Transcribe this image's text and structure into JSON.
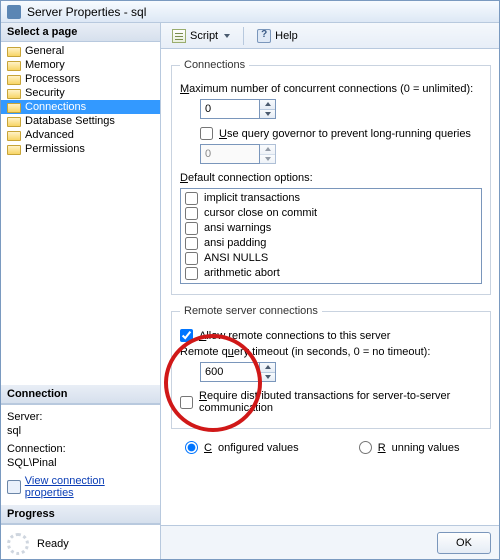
{
  "title": "Server Properties - sql",
  "sidebar": {
    "header": "Select a page",
    "items": [
      {
        "label": "General",
        "selected": false
      },
      {
        "label": "Memory",
        "selected": false
      },
      {
        "label": "Processors",
        "selected": false
      },
      {
        "label": "Security",
        "selected": false
      },
      {
        "label": "Connections",
        "selected": true
      },
      {
        "label": "Database Settings",
        "selected": false
      },
      {
        "label": "Advanced",
        "selected": false
      },
      {
        "label": "Permissions",
        "selected": false
      }
    ]
  },
  "connection_panel": {
    "header": "Connection",
    "server_label": "Server:",
    "server_value": "sql",
    "conn_label": "Connection:",
    "conn_value": "SQL\\Pinal",
    "link": "View connection properties"
  },
  "progress_panel": {
    "header": "Progress",
    "status": "Ready"
  },
  "toolbar": {
    "script": "Script",
    "help": "Help"
  },
  "main": {
    "connections_group": "Connections",
    "max_conn_label": "Maximum number of concurrent connections (0 = unlimited):",
    "max_conn_value": "0",
    "use_gov_label": "Use query governor to prevent long-running queries",
    "gov_value": "0",
    "default_opts_label": "Default connection options:",
    "options": [
      "implicit transactions",
      "cursor close on commit",
      "ansi warnings",
      "ansi padding",
      "ANSI NULLS",
      "arithmetic abort"
    ],
    "remote_group": "Remote server connections",
    "allow_remote": "Allow remote connections to this server",
    "remote_timeout_label": "Remote query timeout (in seconds, 0 = no timeout):",
    "remote_timeout_value": "600",
    "require_dt": "Require distributed transactions for server-to-server communication",
    "configured": "Configured values",
    "running": "Running values"
  },
  "buttons": {
    "ok": "OK"
  }
}
